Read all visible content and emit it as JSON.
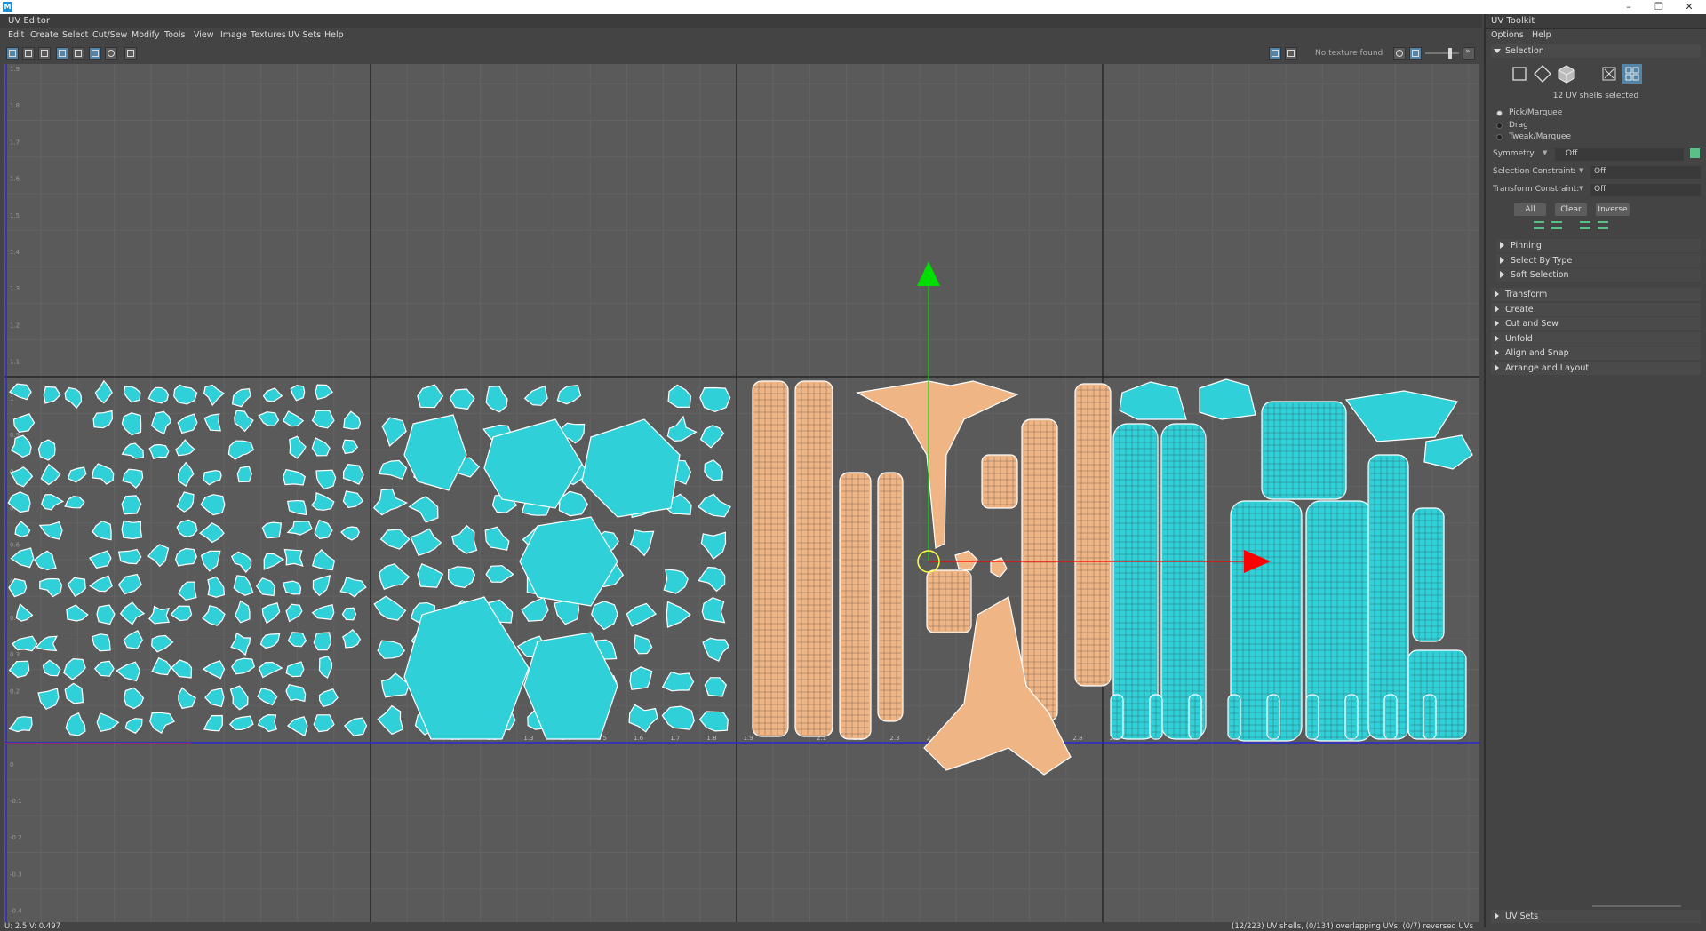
{
  "window": {
    "app_icon": "M",
    "min_icon": "–",
    "max_icon": "❐",
    "close_icon": "✕"
  },
  "uv_editor": {
    "title": "UV Editor",
    "menu": [
      "Edit",
      "Create",
      "Select",
      "Cut/Sew",
      "Modify",
      "Tools",
      "View",
      "Image",
      "Textures",
      "UV Sets",
      "Help"
    ],
    "no_texture": "No texture found",
    "coord_readout": "U: 2.5 V: 0.497",
    "status": "(12/223) UV shells, (0/134) overlapping UVs, (0/7) reversed UVs",
    "grid_labels_left": [
      "1.9",
      "1.8",
      "1.7",
      "1.6",
      "1.5",
      "1.4",
      "1.3",
      "1.2",
      "1.1",
      "1",
      "0.9",
      "0.8",
      "0.7",
      "0.6",
      "0.5",
      "0.4",
      "0.3",
      "0.2",
      "0.1",
      "0",
      "-0.1",
      "-0.2",
      "-0.3",
      "-0.4",
      "-0.5"
    ],
    "grid_labels_bottom": [
      "1.1",
      "1.2",
      "1.3",
      "1.4",
      "1.5",
      "1.6",
      "1.7",
      "1.8",
      "1.9",
      "2.1",
      "2.2",
      "2.3",
      "2.4",
      "2.5",
      "2.6",
      "2.7",
      "2.8",
      "2.9"
    ],
    "colors": {
      "viewport": "#5a5a5a",
      "unselected_shell": "#2fd0d8",
      "selected_shell": "#f0b585",
      "u_axis": "#ff0000",
      "v_axis": "#00dd00"
    }
  },
  "toolkit": {
    "title": "UV Toolkit",
    "menu": [
      "Options",
      "Help"
    ],
    "selection_section": "Selection",
    "shells_selected": "12 UV shells selected",
    "modes": [
      "Pick/Marquee",
      "Drag",
      "Tweak/Marquee"
    ],
    "symmetry_label": "Symmetry:",
    "symmetry_value": "Off",
    "selection_constraint_label": "Selection Constraint:",
    "selection_constraint_value": "Off",
    "transform_constraint_label": "Transform Constraint:",
    "transform_constraint_value": "Off",
    "buttons": [
      "All",
      "Clear",
      "Inverse"
    ],
    "subsections": [
      "Pinning",
      "Select By Type",
      "Soft Selection"
    ],
    "sections": [
      "Transform",
      "Create",
      "Cut and Sew",
      "Unfold",
      "Align and Snap",
      "Arrange and Layout"
    ],
    "uv_sets": "UV Sets"
  }
}
